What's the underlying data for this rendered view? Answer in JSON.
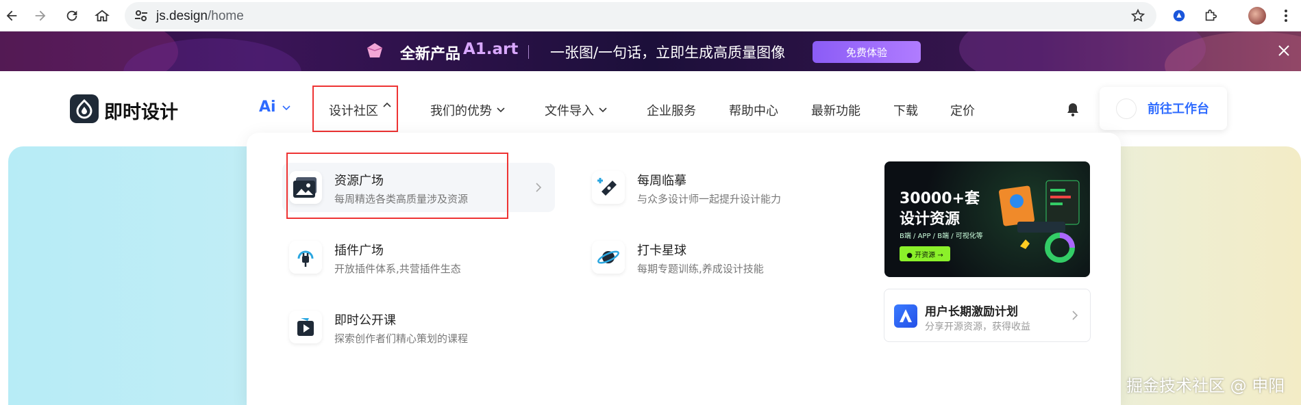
{
  "browser": {
    "url_host": "js.design",
    "url_path": "/home",
    "icons": [
      "back-icon",
      "forward-icon",
      "reload-icon",
      "home-icon",
      "site-settings-icon",
      "bookmark-star-icon",
      "extension-icon",
      "puzzle-icon",
      "avatar",
      "more-icon"
    ]
  },
  "banner": {
    "product_label": "全新产品",
    "product_name": "A1.art",
    "tagline": "一张图/一句话，立即生成高质量图像",
    "cta": "免费体验"
  },
  "header": {
    "logo_text": "即时设计",
    "ai_label": "Ai",
    "menu": [
      {
        "label": "设计社区"
      },
      {
        "label": "我们的优势"
      },
      {
        "label": "文件导入"
      },
      {
        "label": "企业服务"
      },
      {
        "label": "帮助中心"
      },
      {
        "label": "最新功能"
      },
      {
        "label": "下载"
      },
      {
        "label": "定价"
      }
    ],
    "workbench_label": "前往工作台"
  },
  "dropdown": {
    "items": [
      {
        "title": "资源广场",
        "desc": "每周精选各类高质量涉及资源"
      },
      {
        "title": "每周临摹",
        "desc": "与众多设计师一起提升设计能力"
      },
      {
        "title": "插件广场",
        "desc": "开放插件体系,共营插件生态"
      },
      {
        "title": "打卡星球",
        "desc": "每期专题训练,养成设计技能"
      },
      {
        "title": "即时公开课",
        "desc": "探索创作者们精心策划的课程"
      }
    ],
    "promo": {
      "line1": "30000+套",
      "line2": "设计资源",
      "sub": "B端 / APP / B端 / 可视化等",
      "btn": "● 开资源 →"
    },
    "incentive": {
      "title": "用户长期激励计划",
      "desc": "分享开源资源，获得收益"
    }
  },
  "watermark": "掘金技术社区 @ 申阳",
  "colors": {
    "accent": "#2e6bff",
    "highlight_box": "#e33333"
  }
}
